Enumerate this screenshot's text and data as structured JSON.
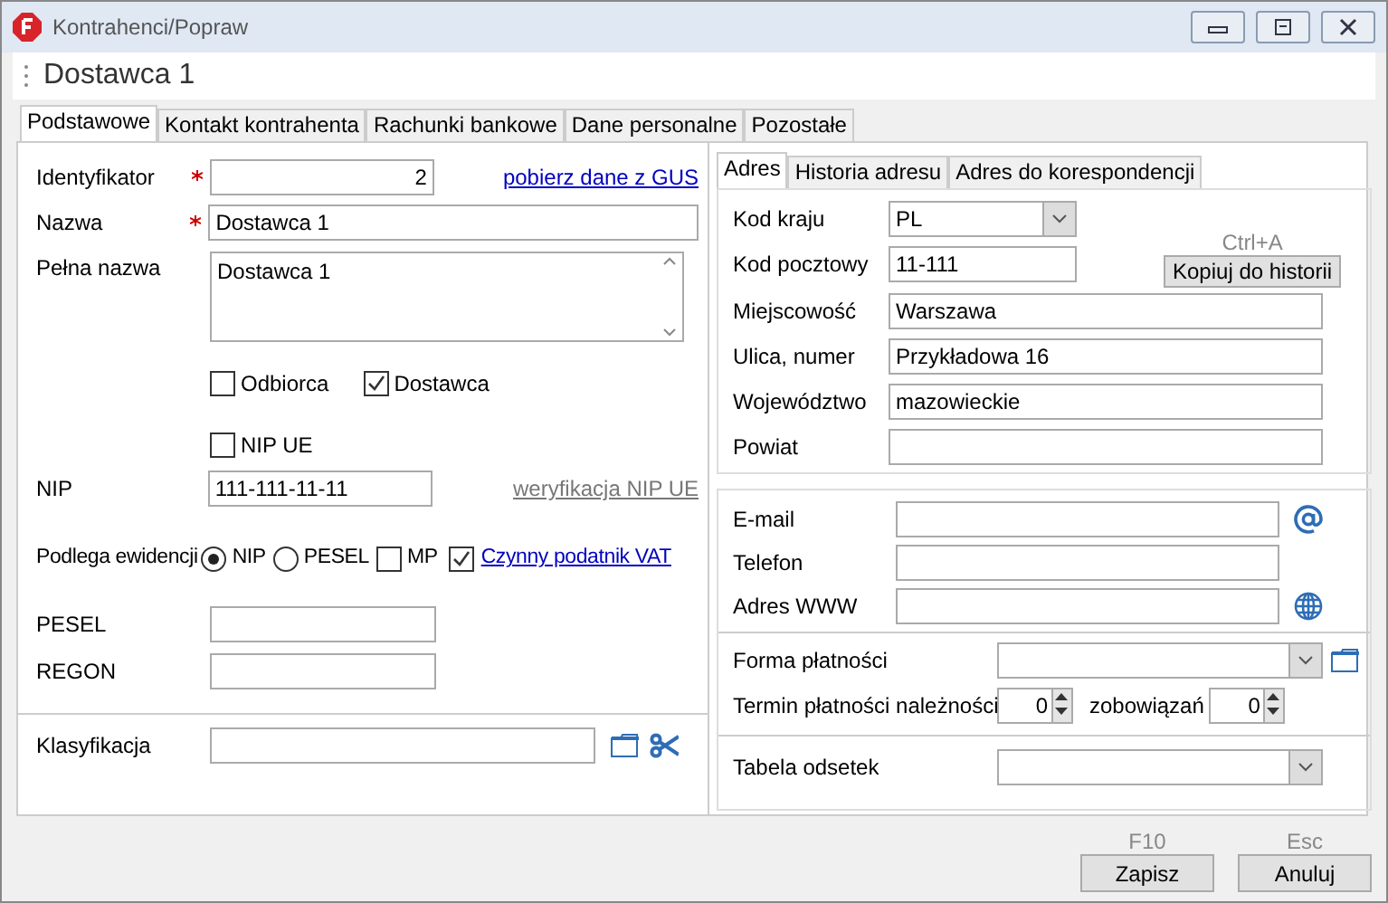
{
  "window": {
    "title": "Kontrahenci/Popraw"
  },
  "header": {
    "title": "Dostawca 1"
  },
  "tabs": [
    {
      "label": "Podstawowe",
      "selected": true
    },
    {
      "label": "Kontakt kontrahenta",
      "selected": false
    },
    {
      "label": "Rachunki bankowe",
      "selected": false
    },
    {
      "label": "Dane personalne",
      "selected": false
    },
    {
      "label": "Pozostałe",
      "selected": false
    }
  ],
  "basic": {
    "identyfikator": {
      "label": "Identyfikator",
      "required": true,
      "value": "2"
    },
    "gus_link": "pobierz dane z GUS",
    "nazwa": {
      "label": "Nazwa",
      "required": true,
      "value": "Dostawca 1"
    },
    "pelna_nazwa": {
      "label": "Pełna nazwa",
      "value": "Dostawca 1"
    },
    "roles": [
      {
        "label": "Odbiorca",
        "checked": false
      },
      {
        "label": "Dostawca",
        "checked": true
      }
    ],
    "nip_ue": {
      "label": "NIP UE",
      "checked": false
    },
    "nip": {
      "label": "NIP",
      "value": "111-111-11-11"
    },
    "nip_ue_link": {
      "label": "weryfikacja NIP UE",
      "disabled": true
    },
    "podlega": {
      "label": "Podlega ewidencji",
      "options": [
        {
          "label": "NIP",
          "selected": true
        },
        {
          "label": "PESEL",
          "selected": false
        }
      ],
      "mp": {
        "label": "MP",
        "checked": false
      },
      "vat": {
        "label": "Czynny podatnik VAT",
        "checked": true
      }
    },
    "pesel": {
      "label": "PESEL"
    },
    "regon": {
      "label": "REGON"
    },
    "klasyfikacja": {
      "label": "Klasyfikacja"
    }
  },
  "address_tabs": [
    {
      "label": "Adres",
      "selected": true
    },
    {
      "label": "Historia adresu",
      "selected": false
    },
    {
      "label": "Adres do korespondencji",
      "selected": false
    }
  ],
  "address": {
    "kod_kraju": {
      "label": "Kod kraju",
      "value": "PL"
    },
    "kod_pocztowy": {
      "label": "Kod pocztowy",
      "value": "11-111"
    },
    "copy_shortcut": "Ctrl+A",
    "copy_button": "Kopiuj do historii",
    "lines": [
      {
        "label": "Miejscowość",
        "value": "Warszawa"
      },
      {
        "label": "Ulica, numer",
        "value": "Przykładowa 16"
      },
      {
        "label": "Województwo",
        "value": "mazowieckie"
      },
      {
        "label": "Powiat"
      }
    ]
  },
  "contact": [
    {
      "label": "E-mail",
      "kind": "email"
    },
    {
      "label": "Telefon",
      "kind": "plain"
    },
    {
      "label": "Adres WWW",
      "kind": "www"
    }
  ],
  "payment": {
    "forma": {
      "label": "Forma płatności"
    },
    "termin": {
      "label": "Termin płatności należności",
      "value": "0"
    },
    "zobowiazan": {
      "label": "zobowiązań",
      "value": "0"
    },
    "tabela": {
      "label": "Tabela odsetek"
    }
  },
  "footer": [
    {
      "shortcut": "F10",
      "label": "Zapisz"
    },
    {
      "shortcut": "Esc",
      "label": "Anuluj"
    }
  ]
}
